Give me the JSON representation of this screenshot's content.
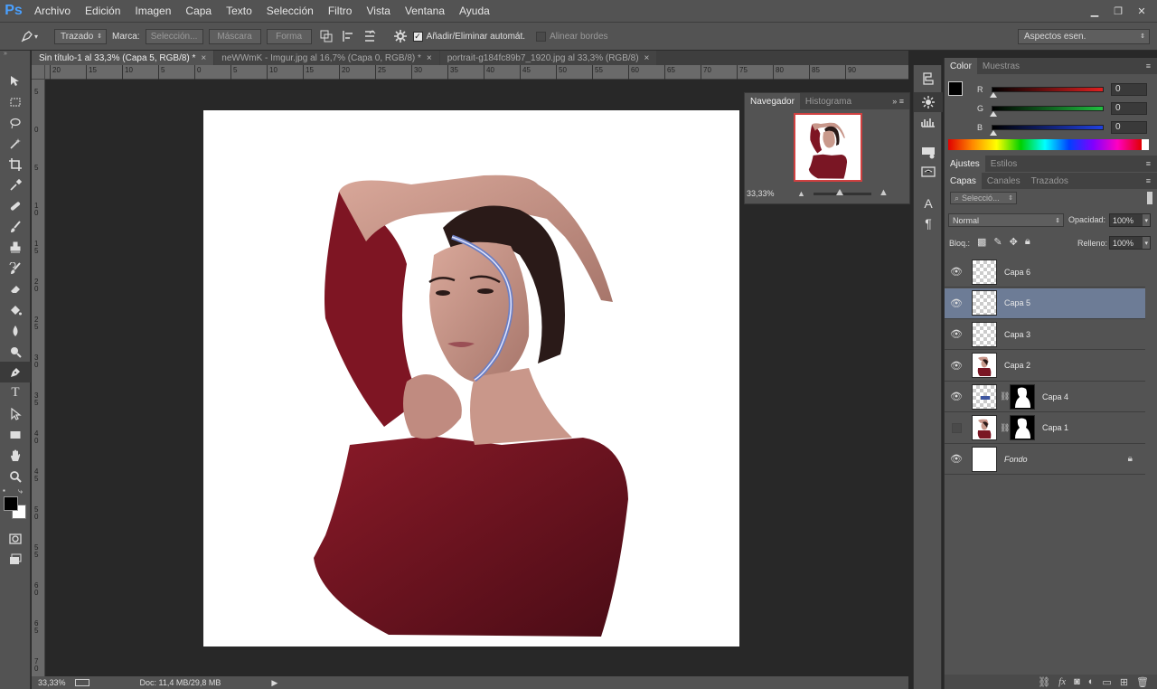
{
  "app": {
    "logo": "Ps"
  },
  "menu": [
    "Archivo",
    "Edición",
    "Imagen",
    "Capa",
    "Texto",
    "Selección",
    "Filtro",
    "Vista",
    "Ventana",
    "Ayuda"
  ],
  "window_controls": {
    "minimize": "▁",
    "restore": "❐",
    "close": "✕"
  },
  "options_bar": {
    "tool_mode": "Trazado",
    "make_label": "Marca:",
    "selection_btn": "Selección...",
    "mask_btn": "Máscara",
    "shape_btn": "Forma",
    "auto_add_delete": "Añadir/Eliminar automát.",
    "align_edges": "Alinear bordes",
    "workspace": "Aspectos esen."
  },
  "tabs": [
    {
      "label": "Sin título-1 al 33,3% (Capa 5, RGB/8) *",
      "close": "×"
    },
    {
      "label": "neWWmK - Imgur.jpg al 16,7% (Capa 0, RGB/8) *",
      "close": "×"
    },
    {
      "label": "portrait-g184fc89b7_1920.jpg al 33,3% (RGB/8)",
      "close": "×"
    }
  ],
  "hruler_ticks": [
    "20",
    "15",
    "10",
    "5",
    "0",
    "5",
    "10",
    "15",
    "20",
    "25",
    "30",
    "35",
    "40",
    "45",
    "50",
    "55",
    "60",
    "65",
    "70",
    "75",
    "80",
    "85",
    "90"
  ],
  "vruler_ticks": [
    "5",
    "0",
    "5",
    "1\n0",
    "1\n5",
    "2\n0",
    "2\n5",
    "3\n0",
    "3\n5",
    "4\n0",
    "4\n5",
    "5\n0",
    "5\n5",
    "6\n0",
    "6\n5",
    "7\n0"
  ],
  "status": {
    "zoom": "33,33%",
    "doc": "Doc: 11,4 MB/29,8 MB",
    "arrow": "▶"
  },
  "navigator": {
    "tabs": [
      "Navegador",
      "Histograma"
    ],
    "zoom": "33,33%",
    "zoom_fraction": 0.45
  },
  "color_panel": {
    "tabs": [
      "Color",
      "Muestras"
    ],
    "channels": [
      {
        "label": "R",
        "value": "0",
        "color": "#e02020"
      },
      {
        "label": "G",
        "value": "0",
        "color": "#20c040"
      },
      {
        "label": "B",
        "value": "0",
        "color": "#2040e0"
      }
    ]
  },
  "adjust_tabs": [
    "Ajustes",
    "Estilos"
  ],
  "layers_panel": {
    "tabs": [
      "Capas",
      "Canales",
      "Trazados"
    ],
    "filter_placeholder": "Selecció...",
    "blend_mode": "Normal",
    "opacity_label": "Opacidad:",
    "opacity": "100%",
    "lock_label": "Bloq.:",
    "fill_label": "Relleno:",
    "fill": "100%",
    "layers": [
      {
        "name": "Capa 6",
        "visible": true,
        "selected": false,
        "thumb": "transparent",
        "mask": false
      },
      {
        "name": "Capa 5",
        "visible": true,
        "selected": true,
        "thumb": "transparent",
        "mask": false
      },
      {
        "name": "Capa 3",
        "visible": true,
        "selected": false,
        "thumb": "transparent",
        "mask": false
      },
      {
        "name": "Capa 2",
        "visible": true,
        "selected": false,
        "thumb": "portrait",
        "mask": false
      },
      {
        "name": "Capa 4",
        "visible": true,
        "selected": false,
        "thumb": "stroke",
        "mask": true
      },
      {
        "name": "Capa 1",
        "visible": false,
        "selected": false,
        "thumb": "portrait",
        "mask": true
      },
      {
        "name": "Fondo",
        "visible": true,
        "selected": false,
        "thumb": "white",
        "mask": false,
        "locked": true
      }
    ]
  },
  "colors": {
    "accent": "#6d7c96",
    "panel": "#535353",
    "workspace": "#282828"
  }
}
